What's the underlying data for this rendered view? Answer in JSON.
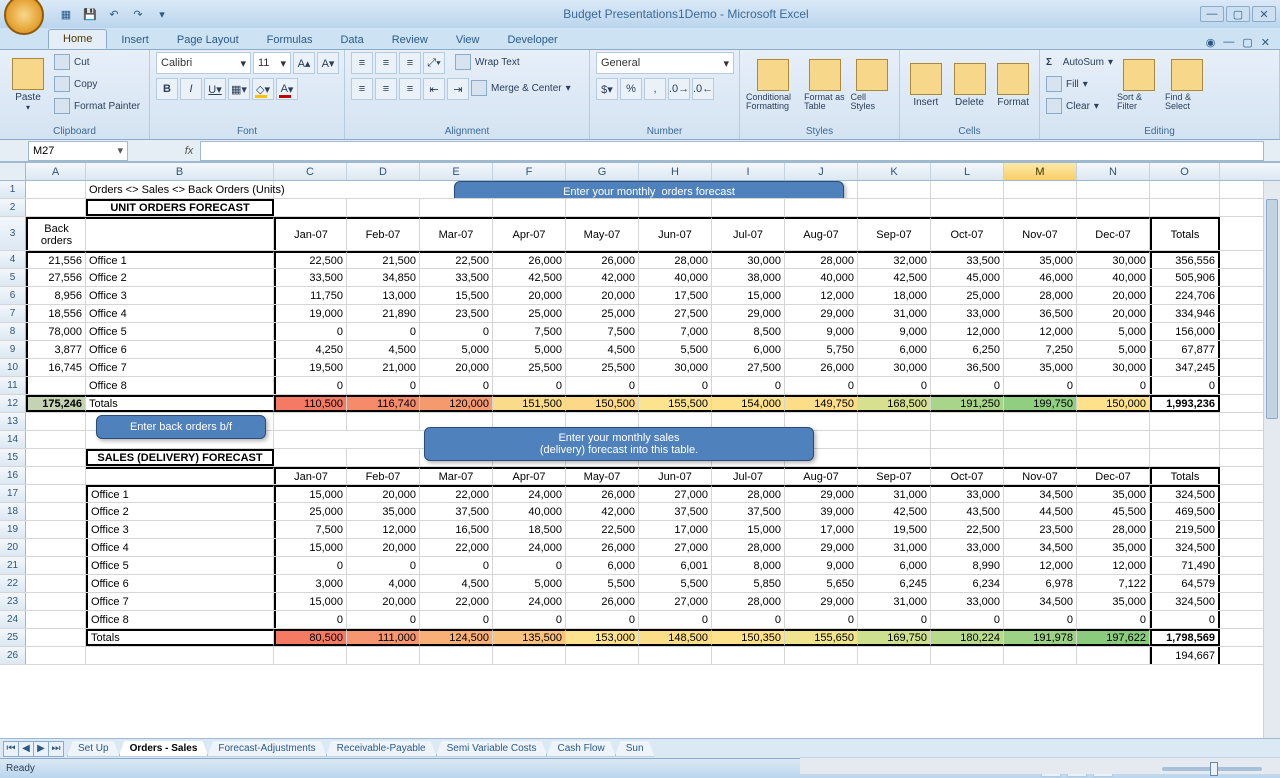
{
  "app": {
    "title": "Budget Presentations1Demo - Microsoft Excel",
    "name_box": "M27",
    "formula": "",
    "status": "Ready",
    "zoom": "100%"
  },
  "qat": [
    "save-icon",
    "undo-icon",
    "redo-icon"
  ],
  "tabs": [
    "Home",
    "Insert",
    "Page Layout",
    "Formulas",
    "Data",
    "Review",
    "View",
    "Developer"
  ],
  "active_tab": "Home",
  "ribbon": {
    "clipboard": {
      "paste": "Paste",
      "cut": "Cut",
      "copy": "Copy",
      "format_painter": "Format Painter",
      "title": "Clipboard"
    },
    "font": {
      "name": "Calibri",
      "size": "11",
      "title": "Font"
    },
    "alignment": {
      "wrap": "Wrap Text",
      "merge": "Merge & Center",
      "title": "Alignment"
    },
    "number": {
      "format": "General",
      "title": "Number"
    },
    "styles": {
      "cond": "Conditional Formatting",
      "fmt": "Format as Table",
      "cell": "Cell Styles",
      "title": "Styles"
    },
    "cells": {
      "ins": "Insert",
      "del": "Delete",
      "fmt": "Format",
      "title": "Cells"
    },
    "editing": {
      "sum": "AutoSum",
      "fill": "Fill",
      "clear": "Clear",
      "sort": "Sort & Filter",
      "find": "Find & Select",
      "title": "Editing"
    }
  },
  "columns": [
    "A",
    "B",
    "C",
    "D",
    "E",
    "F",
    "G",
    "H",
    "I",
    "J",
    "K",
    "L",
    "M",
    "N",
    "O"
  ],
  "selected_col": "M",
  "row_numbers": [
    1,
    2,
    3,
    4,
    5,
    6,
    7,
    8,
    9,
    10,
    11,
    12,
    13,
    14,
    15,
    16,
    17,
    18,
    19,
    20,
    21,
    22,
    23,
    24,
    25,
    26
  ],
  "sheets": [
    "Set Up",
    "Orders - Sales",
    "Forecast-Adjustments",
    "Receivable-Payable",
    "Semi Variable Costs",
    "Cash Flow",
    "Sun"
  ],
  "active_sheet": "Orders - Sales",
  "title_line": "Orders <> Sales <> Back Orders (Units)",
  "section1_title": "UNIT ORDERS FORECAST",
  "section2_title": "SALES (DELIVERY) FORECAST",
  "back_orders_hdr": "Back orders",
  "callout1": "Enter your monthly  orders forecast into this table.",
  "callout2": "Enter back orders b/f",
  "callout3": "Enter your monthly sales (delivery) forecast into this table.",
  "months": [
    "Jan-07",
    "Feb-07",
    "Mar-07",
    "Apr-07",
    "May-07",
    "Jun-07",
    "Jul-07",
    "Aug-07",
    "Sep-07",
    "Oct-07",
    "Nov-07",
    "Dec-07"
  ],
  "totals_hdr": "Totals",
  "offices": [
    "Office 1",
    "Office 2",
    "Office 3",
    "Office 4",
    "Office 5",
    "Office 6",
    "Office 7",
    "Office 8"
  ],
  "back_orders": [
    "21,556",
    "27,556",
    "8,956",
    "18,556",
    "78,000",
    "3,877",
    "16,745",
    ""
  ],
  "back_orders_total": "175,246",
  "table1": [
    [
      "22,500",
      "21,500",
      "22,500",
      "26,000",
      "26,000",
      "28,000",
      "30,000",
      "28,000",
      "32,000",
      "33,500",
      "35,000",
      "30,000",
      "356,556"
    ],
    [
      "33,500",
      "34,850",
      "33,500",
      "42,500",
      "42,000",
      "40,000",
      "38,000",
      "40,000",
      "42,500",
      "45,000",
      "46,000",
      "40,000",
      "505,906"
    ],
    [
      "11,750",
      "13,000",
      "15,500",
      "20,000",
      "20,000",
      "17,500",
      "15,000",
      "12,000",
      "18,000",
      "25,000",
      "28,000",
      "20,000",
      "224,706"
    ],
    [
      "19,000",
      "21,890",
      "23,500",
      "25,000",
      "25,000",
      "27,500",
      "29,000",
      "29,000",
      "31,000",
      "33,000",
      "36,500",
      "20,000",
      "334,946"
    ],
    [
      "0",
      "0",
      "0",
      "7,500",
      "7,500",
      "7,000",
      "8,500",
      "9,000",
      "9,000",
      "12,000",
      "12,000",
      "5,000",
      "156,000"
    ],
    [
      "4,250",
      "4,500",
      "5,000",
      "5,000",
      "4,500",
      "5,500",
      "6,000",
      "5,750",
      "6,000",
      "6,250",
      "7,250",
      "5,000",
      "67,877"
    ],
    [
      "19,500",
      "21,000",
      "20,000",
      "25,500",
      "25,500",
      "30,000",
      "27,500",
      "26,000",
      "30,000",
      "36,500",
      "35,000",
      "30,000",
      "347,245"
    ],
    [
      "0",
      "0",
      "0",
      "0",
      "0",
      "0",
      "0",
      "0",
      "0",
      "0",
      "0",
      "0",
      "0"
    ]
  ],
  "table1_totals": [
    "110,500",
    "116,740",
    "120,000",
    "151,500",
    "150,500",
    "155,500",
    "154,000",
    "149,750",
    "168,500",
    "191,250",
    "199,750",
    "150,000",
    "1,993,236"
  ],
  "table1_colors": [
    "#f47a64",
    "#f58b6a",
    "#f59a6e",
    "#fadb8a",
    "#fbd988",
    "#fde38d",
    "#fde18b",
    "#fcdd88",
    "#d7e08f",
    "#a8d58a",
    "#90ce82",
    "#fde18b",
    ""
  ],
  "table2": [
    [
      "15,000",
      "20,000",
      "22,000",
      "24,000",
      "26,000",
      "27,000",
      "28,000",
      "29,000",
      "31,000",
      "33,000",
      "34,500",
      "35,000",
      "324,500"
    ],
    [
      "25,000",
      "35,000",
      "37,500",
      "40,000",
      "42,000",
      "37,500",
      "37,500",
      "39,000",
      "42,500",
      "43,500",
      "44,500",
      "45,500",
      "469,500"
    ],
    [
      "7,500",
      "12,000",
      "16,500",
      "18,500",
      "22,500",
      "17,000",
      "15,000",
      "17,000",
      "19,500",
      "22,500",
      "23,500",
      "28,000",
      "219,500"
    ],
    [
      "15,000",
      "20,000",
      "22,000",
      "24,000",
      "26,000",
      "27,000",
      "28,000",
      "29,000",
      "31,000",
      "33,000",
      "34,500",
      "35,000",
      "324,500"
    ],
    [
      "0",
      "0",
      "0",
      "0",
      "6,000",
      "6,001",
      "8,000",
      "9,000",
      "6,000",
      "8,990",
      "12,000",
      "12,000",
      "71,490"
    ],
    [
      "3,000",
      "4,000",
      "4,500",
      "5,000",
      "5,500",
      "5,500",
      "5,850",
      "5,650",
      "6,245",
      "6,234",
      "6,978",
      "7,122",
      "64,579"
    ],
    [
      "15,000",
      "20,000",
      "22,000",
      "24,000",
      "26,000",
      "27,000",
      "28,000",
      "29,000",
      "31,000",
      "33,000",
      "34,500",
      "35,000",
      "324,500"
    ],
    [
      "0",
      "0",
      "0",
      "0",
      "0",
      "0",
      "0",
      "0",
      "0",
      "0",
      "0",
      "0",
      "0"
    ]
  ],
  "table2_totals": [
    "80,500",
    "111,000",
    "124,500",
    "135,500",
    "153,000",
    "148,500",
    "150,350",
    "155,650",
    "169,750",
    "180,224",
    "191,978",
    "197,622",
    "1,798,569"
  ],
  "table2_colors": [
    "#f47a64",
    "#f69670",
    "#f8b077",
    "#fac27f",
    "#fde38d",
    "#fcdd88",
    "#fde18b",
    "#f0e58e",
    "#cde08e",
    "#b8da8c",
    "#9cd186",
    "#8acb7e",
    ""
  ],
  "extra_total": "194,667"
}
